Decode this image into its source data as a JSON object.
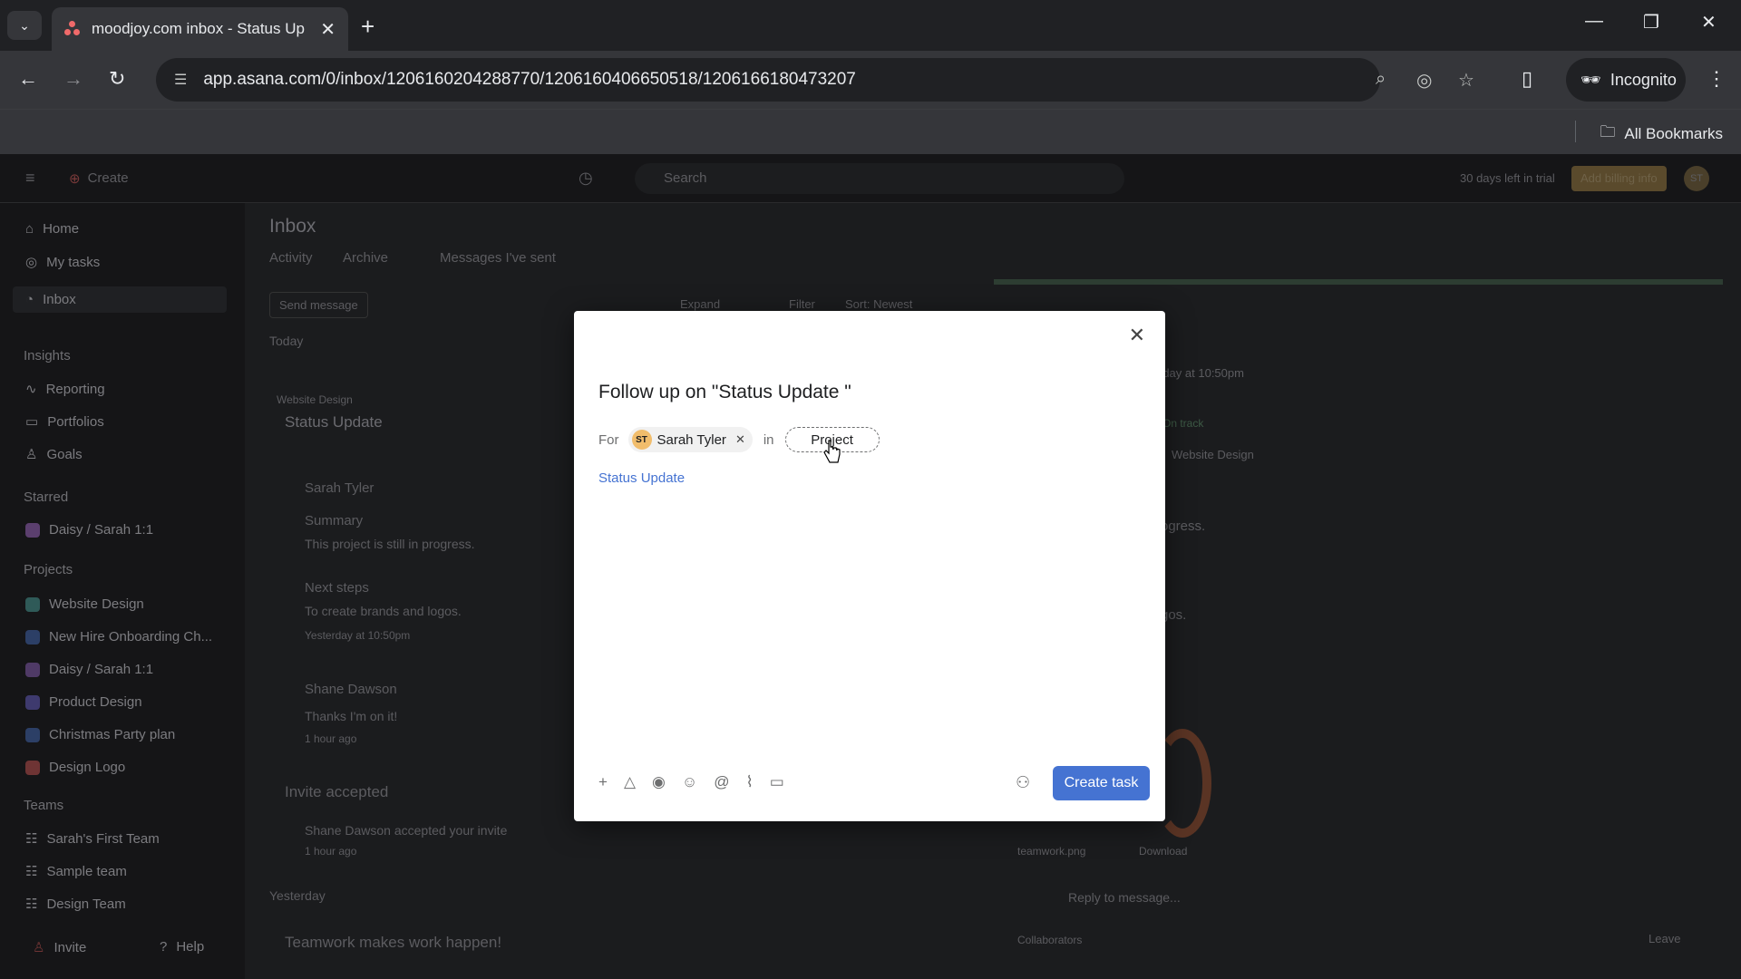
{
  "browser": {
    "tab_title": "moodjoy.com inbox - Status Up",
    "url": "app.asana.com/0/inbox/1206160204288770/1206160406650518/1206166180473207",
    "incognito_label": "Incognito",
    "bookmarks_label": "All Bookmarks"
  },
  "topbar": {
    "create_label": "Create",
    "search_placeholder": "Search",
    "trial_text": "30 days left in trial",
    "billing_label": "Add billing info",
    "user_initials": "ST"
  },
  "sidebar": {
    "nav": [
      "Home",
      "My tasks",
      "Inbox"
    ],
    "insights_heading": "Insights",
    "insights": [
      "Reporting",
      "Portfolios",
      "Goals"
    ],
    "starred_heading": "Starred",
    "starred": [
      "Daisy / Sarah 1:1"
    ],
    "projects_heading": "Projects",
    "projects": [
      {
        "label": "Website Design",
        "color": "#4ecbc4"
      },
      {
        "label": "New Hire Onboarding Ch...",
        "color": "#4573d2"
      },
      {
        "label": "Daisy / Sarah 1:1",
        "color": "#aa62e3"
      },
      {
        "label": "Product Design",
        "color": "#7a6ff0"
      },
      {
        "label": "Christmas Party plan",
        "color": "#4573d2"
      },
      {
        "label": "Design Logo",
        "color": "#f06a6a"
      }
    ],
    "teams_heading": "Teams",
    "teams": [
      "Sarah's First Team",
      "Sample team",
      "Design Team"
    ],
    "invite_label": "Invite",
    "help_label": "Help"
  },
  "inbox": {
    "title": "Inbox",
    "tabs": [
      "Activity",
      "Archive",
      "Messages I've sent"
    ],
    "send_message": "Send message",
    "toolbar": [
      "Expand",
      "Filter",
      "Sort: Newest"
    ],
    "today": "Today",
    "project_tag": "Website Design",
    "item_title": "Status Update",
    "author": "Sarah Tyler",
    "summary_heading": "Summary",
    "summary_text": "This project is still in progress.",
    "next_heading": "Next steps",
    "next_text": "To create brands and logos.",
    "timestamp1": "Yesterday at 10:50pm",
    "commenter": "Shane Dawson",
    "comment": "Thanks I'm on it!",
    "time2": "1 hour ago",
    "invite_title": "Invite accepted",
    "invite_text": "Shane Dawson accepted your invite",
    "time3": "1 hour ago",
    "yesterday": "Yesterday",
    "teamwork": "Teamwork makes work happen!"
  },
  "detail": {
    "ts": "rday at 10:50pm",
    "ontrack": "On track",
    "proj": "Website Design",
    "frag1": "ogress.",
    "frag2": "gos.",
    "attachment": "teamwork.png",
    "download": "Download",
    "reply_placeholder": "Reply to message...",
    "collaborators": "Collaborators",
    "leave": "Leave"
  },
  "modal": {
    "title": "Follow up on \"Status Update \"",
    "for_label": "For",
    "assignee_initials": "ST",
    "assignee_name": "Sarah Tyler",
    "in_label": "in",
    "project_button": "Project",
    "description_link": "Status Update",
    "create_button": "Create task"
  }
}
